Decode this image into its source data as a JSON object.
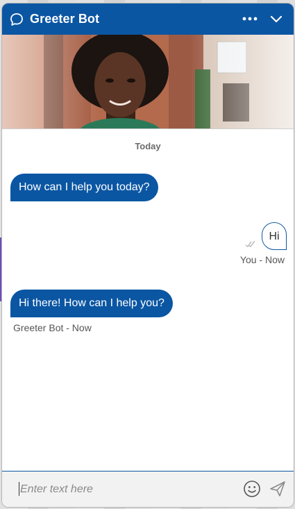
{
  "header": {
    "title": "Greeter Bot",
    "icons": {
      "chat": "chat-bubble-icon",
      "more": "more-horizontal-icon",
      "collapse": "chevron-down-icon"
    },
    "color": "#0b56a3"
  },
  "hero": {
    "alt": "Greeter Bot avatar photo",
    "icon": "person-photo"
  },
  "messages": {
    "day_separator": "Today",
    "items": [
      {
        "from": "bot",
        "text": "How can I help you today?"
      },
      {
        "from": "user",
        "text": "Hi",
        "meta": "You - Now",
        "status_icon": "double-check-icon"
      },
      {
        "from": "bot",
        "text": "Hi there! How can I help you?",
        "meta": "Greeter Bot - Now"
      }
    ]
  },
  "composer": {
    "placeholder": "Enter text here",
    "value": "",
    "icons": {
      "emoji": "smiley-icon",
      "send": "send-icon"
    }
  },
  "colors": {
    "brand": "#0b56a3",
    "bubble_text": "#ffffff",
    "meta_text": "#555555"
  }
}
